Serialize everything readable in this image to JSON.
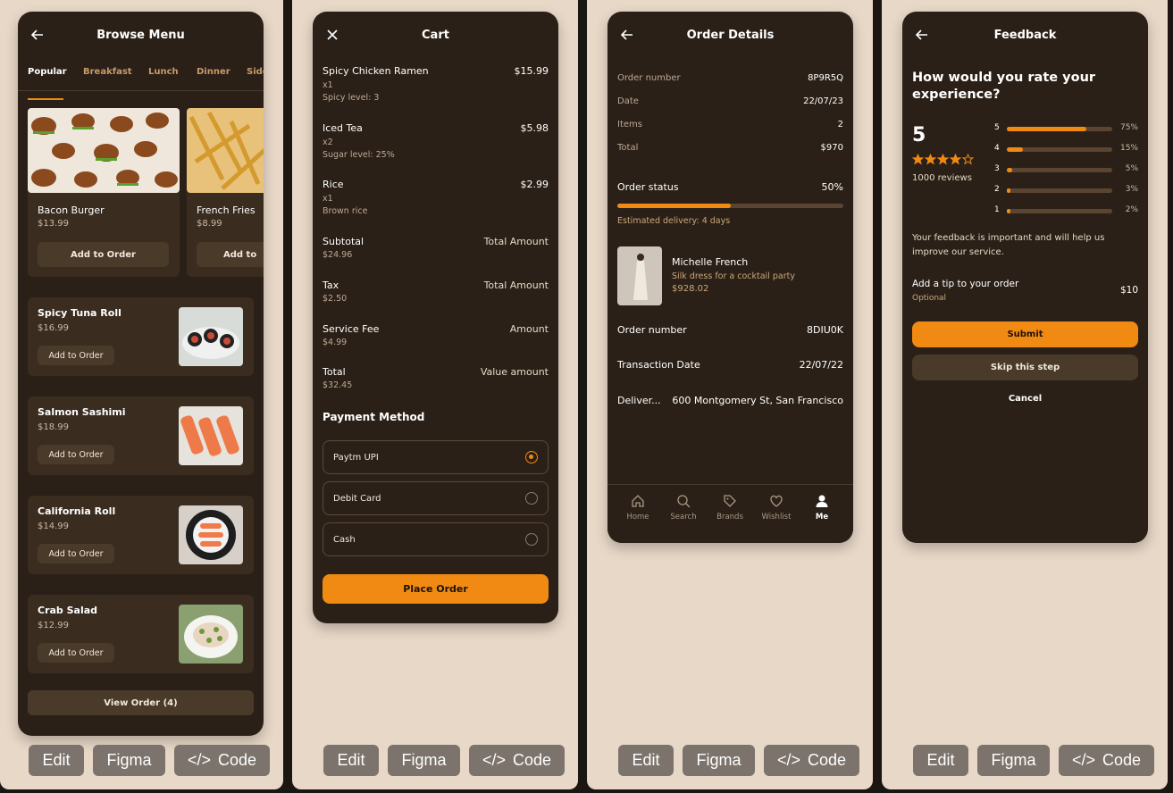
{
  "panel_actions": {
    "edit": "Edit",
    "figma": "Figma",
    "code_icon": "</>",
    "code": "Code"
  },
  "browse": {
    "title": "Browse Menu",
    "tabs": [
      "Popular",
      "Breakfast",
      "Lunch",
      "Dinner",
      "Side"
    ],
    "featured": [
      {
        "name": "Bacon Burger",
        "price": "$13.99",
        "button": "Add to Order"
      },
      {
        "name": "French Fries",
        "price": "$8.99",
        "button": "Add to"
      }
    ],
    "items": [
      {
        "name": "Spicy Tuna Roll",
        "price": "$16.99",
        "button": "Add to Order"
      },
      {
        "name": "Salmon Sashimi",
        "price": "$18.99",
        "button": "Add to Order"
      },
      {
        "name": "California Roll",
        "price": "$14.99",
        "button": "Add to Order"
      },
      {
        "name": "Crab Salad",
        "price": "$12.99",
        "button": "Add to Order"
      }
    ],
    "view_order": "View Order (4)"
  },
  "cart": {
    "title": "Cart",
    "items": [
      {
        "name": "Spicy Chicken Ramen",
        "qty": "x1",
        "note": "Spicy level: 3",
        "price": "$15.99"
      },
      {
        "name": "Iced Tea",
        "qty": "x2",
        "note": "Sugar level: 25%",
        "price": "$5.98"
      },
      {
        "name": "Rice",
        "qty": "x1",
        "note": "Brown rice",
        "price": "$2.99"
      }
    ],
    "totals": [
      {
        "label": "Subtotal",
        "value": "$24.96",
        "right": "Total Amount"
      },
      {
        "label": "Tax",
        "value": "$2.50",
        "right": "Total Amount"
      },
      {
        "label": "Service Fee",
        "value": "$4.99",
        "right": "Amount"
      },
      {
        "label": "Total",
        "value": "$32.45",
        "right": "Value amount"
      }
    ],
    "payment_title": "Payment Method",
    "payment_options": [
      {
        "label": "Paytm UPI",
        "selected": true
      },
      {
        "label": "Debit Card",
        "selected": false
      },
      {
        "label": "Cash",
        "selected": false
      }
    ],
    "place_order": "Place Order"
  },
  "order": {
    "title": "Order Details",
    "summary": [
      {
        "label": "Order number",
        "value": "8P9R5Q"
      },
      {
        "label": "Date",
        "value": "22/07/23"
      },
      {
        "label": "Items",
        "value": "2"
      },
      {
        "label": "Total",
        "value": "$970"
      }
    ],
    "status_label": "Order status",
    "status_value": "50%",
    "status_progress": 0.5,
    "delivery": "Estimated delivery: 4 days",
    "product": {
      "name": "Michelle French",
      "desc": "Silk dress for a cocktail party",
      "price": "$928.02"
    },
    "details": [
      {
        "label": "Order number",
        "value": "8DIU0K"
      },
      {
        "label": "Transaction Date",
        "value": "22/07/22"
      },
      {
        "label": "Deliver...",
        "value": "600 Montgomery St, San Francisco"
      }
    ],
    "nav": [
      "Home",
      "Search",
      "Brands",
      "Wishlist",
      "Me"
    ]
  },
  "feedback": {
    "title": "Feedback",
    "question": "How would you rate your experience?",
    "score": "5",
    "stars_filled": 4,
    "reviews": "1000 reviews",
    "breakdown": [
      {
        "star": "5",
        "pct": "75%",
        "frac": 0.75
      },
      {
        "star": "4",
        "pct": "15%",
        "frac": 0.15
      },
      {
        "star": "3",
        "pct": "5%",
        "frac": 0.05
      },
      {
        "star": "2",
        "pct": "3%",
        "frac": 0.03
      },
      {
        "star": "1",
        "pct": "2%",
        "frac": 0.02
      }
    ],
    "note": "Your feedback is important and will help us improve our service.",
    "tip_label": "Add a tip to your order",
    "tip_optional": "Optional",
    "tip_value": "$10",
    "submit": "Submit",
    "skip": "Skip this step",
    "cancel": "Cancel"
  },
  "colors": {
    "accent": "#f08a12",
    "panel": "#2b2017",
    "card": "#3a2c1f",
    "frame": "#e8d8c8"
  }
}
